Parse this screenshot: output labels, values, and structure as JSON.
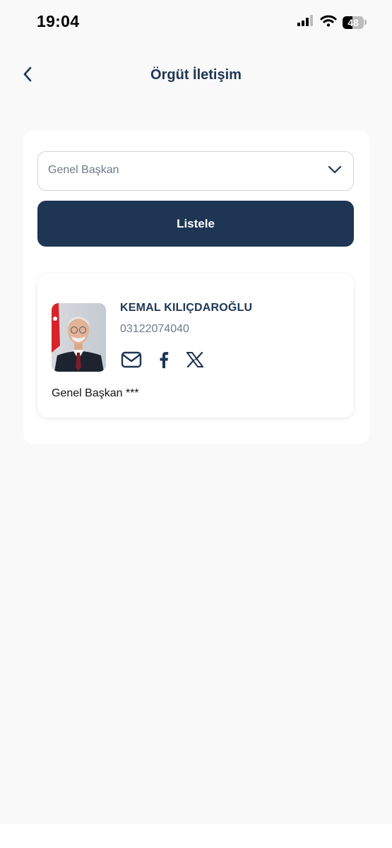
{
  "status_bar": {
    "time": "19:04",
    "battery_level": "48",
    "battery_fraction": 0.48
  },
  "header": {
    "title": "Örgüt İletişim",
    "back_icon": "chevron-left-icon"
  },
  "filter": {
    "selected_value": "Genel Başkan",
    "chevron_icon": "chevron-down-icon",
    "list_button_label": "Listele"
  },
  "contacts": [
    {
      "name": "KEMAL KILIÇDAROĞLU",
      "phone": "03122074040",
      "title": "Genel Başkan ***",
      "social": [
        "mail-icon",
        "facebook-icon",
        "x-icon"
      ]
    }
  ],
  "colors": {
    "primary": "#1e3553",
    "background": "#f9f9f9",
    "muted_text": "#6f7a88"
  }
}
